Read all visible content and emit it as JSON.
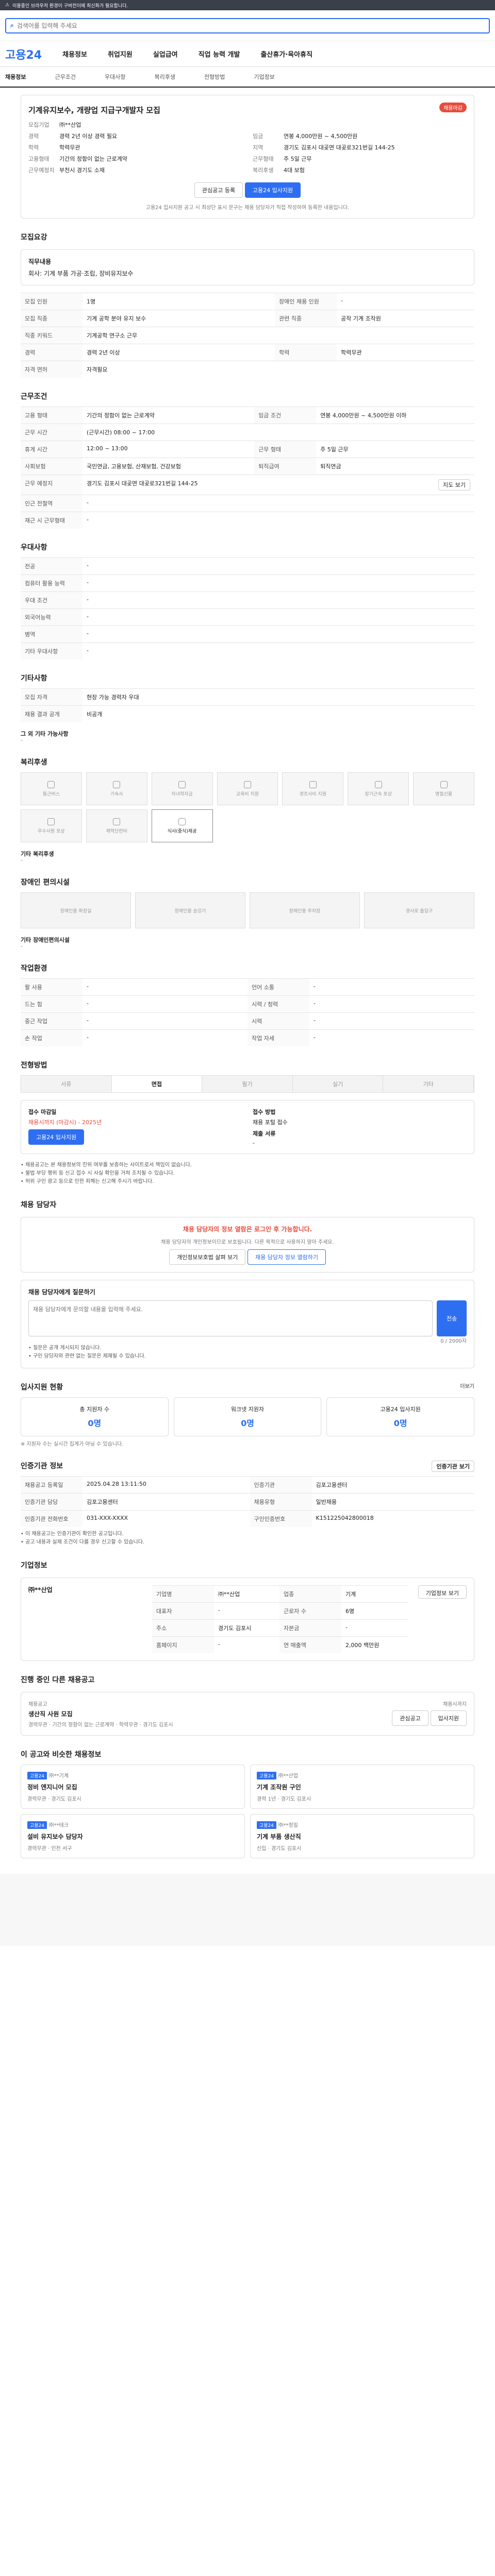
{
  "topbar": {
    "text": "이용중인 브라우저 환경이 구버전이에 최신화가 필요합니다."
  },
  "search": {
    "placeholder": "검색어를 입력해 주세요",
    "icon": "search-icon"
  },
  "gnb": {
    "logo": "고용24",
    "items": [
      "채용정보",
      "취업지원",
      "실업급여",
      "직업 능력 개발",
      "출산휴가·육아휴직"
    ]
  },
  "subnav": [
    "채용정보",
    "근무조건",
    "우대사항",
    "복리후생",
    "전형방법",
    "기업정보"
  ],
  "job": {
    "title": "기계유지보수, 개량업 지급구개발자 모집",
    "badge": "채용마감",
    "company_label": "모집기업",
    "company": "㈜**산업",
    "left": [
      [
        "경력",
        "경력 2년 이상 경력 필요"
      ],
      [
        "학력",
        "학력무관"
      ],
      [
        "고용형태",
        "기간의 정함이 없는 근로계약"
      ],
      [
        "근무예정지",
        "부천시 경기도 소재"
      ]
    ],
    "right": [
      [
        "임금",
        "연봉 4,000만원 ~ 4,500만원"
      ],
      [
        "지역",
        "경기도 김포시 대곶면 대곶로321번길 144-25"
      ],
      [
        "근무형태",
        "주 5일 근무"
      ],
      [
        "복리후생",
        "4대 보험"
      ]
    ],
    "scrap": "관심공고 등록",
    "apply": "고용24 입사지원",
    "note": "고용24 입사지원 공고 시 최상단 표시 문구는 채용 담당자가 직접 작성하여 등록한 내용입니다."
  },
  "recruit": {
    "title": "모집요강",
    "duty_label": "직무내용",
    "duty": "회사: 기계 부품 가공·조립, 장비유지보수",
    "rows": [
      [
        "모집 인원",
        "1명",
        "장애인 채용 인원",
        "-"
      ],
      [
        "모집 직종",
        "기계 공학 분야 유지 보수",
        "관련 직종",
        "공작 기계 조작원"
      ],
      [
        "직종 키워드",
        "기계공학 연구소 근무",
        "",
        ""
      ],
      [
        "경력",
        "경력 2년 이상",
        "학력",
        "학력무관"
      ],
      [
        "자격 면허",
        "자격필요",
        "",
        ""
      ]
    ]
  },
  "cond": {
    "title": "근무조건",
    "rows": [
      [
        "고용 형태",
        "기간의 정함이 없는 근로계약",
        "임금 조건",
        "연봉 4,000만원 ~ 4,500만원 이하"
      ],
      [
        "근무 시간",
        "(근무시간) 08:00 ~ 17:00",
        "",
        ""
      ],
      [
        "휴게 시간",
        "12:00 ~ 13:00",
        "근무 형태",
        "주 5일 근무"
      ],
      [
        "사회보험",
        "국민연금, 고용보험, 산재보험, 건강보험",
        "퇴직급여",
        "퇴직연금"
      ],
      [
        "근무 예정지",
        "경기도 김포시 대곶면 대곶로321번길 144-25",
        "",
        ""
      ],
      [
        "인근 전철역",
        "-",
        "",
        ""
      ],
      [
        "재근 시 근무형태",
        "-",
        "",
        ""
      ]
    ],
    "map_btn": "지도 보기"
  },
  "pref": {
    "title": "우대사항",
    "rows": [
      [
        "전공",
        "-"
      ],
      [
        "컴퓨터 활용 능력",
        "-"
      ],
      [
        "우대 조건",
        "-"
      ],
      [
        "외국어능력",
        "-"
      ],
      [
        "병역",
        "-"
      ],
      [
        "기타 우대사항",
        "-"
      ]
    ]
  },
  "etc": {
    "title": "기타사항",
    "rows": [
      [
        "모집 자격",
        "현장 가능 경력자 우대"
      ],
      [
        "채용 결과 공개",
        "비공개"
      ]
    ],
    "sub": "그 외 기타 가능사항",
    "sub_val": "-"
  },
  "welfare": {
    "title": "복리후생",
    "items": [
      "통근버스",
      "기숙사",
      "자녀학자금",
      "교육비 지원",
      "경조사비 지원",
      "장기근속 포상",
      "명절선물",
      "우수사원 포상",
      "체력단련비",
      "식사(중식)제공"
    ],
    "on": [
      9
    ],
    "etc_title": "기타 복리후생",
    "etc_val": "-"
  },
  "disability": {
    "title": "장애인 편의시설",
    "items": [
      "장애인용 화장실",
      "장애인용 승강기",
      "장애인용 주차장",
      "경사로 출입구"
    ],
    "etc_title": "기타 장애인편의시설",
    "etc_val": "-"
  },
  "env": {
    "title": "작업환경",
    "rows": [
      [
        "팔 사용",
        "-",
        "언어 소통",
        "-"
      ],
      [
        "드는 힘",
        "-",
        "시력 / 청력",
        "-"
      ],
      [
        "중근 작업",
        "-",
        "시력",
        "-"
      ],
      [
        "손 작업",
        "-",
        "작업 자세",
        "-"
      ]
    ]
  },
  "process": {
    "title": "전형방법",
    "steps": [
      "서류",
      "면접",
      "필기",
      "실기",
      "기타"
    ],
    "on": [
      1
    ],
    "apply_title": "접수 마감일",
    "apply_val": "채용시까지 (마감시) - 2025년",
    "submit_title": "접수 방법",
    "submit_val": "채용 포털 접수",
    "docs_title": "제출 서류",
    "docs_val": "-",
    "btn": "고용24 입사지원"
  },
  "notices": [
    "• 채용공고는 본 채용정보의 진위 여부를 보증하는 사이트로서 책임이 없습니다.",
    "• 불법 부당 행위 등 신고 접수 시 사실 확인을 거쳐 조치될 수 있습니다.",
    "• 허위 구인 광고 등으로 인한 피해는 신고해 주시기 바랍니다."
  ],
  "inquiry": {
    "title": "채용 담당자",
    "alert": "채용 담당자의 정보 열람은 로그인 후 가능합니다.",
    "desc": "채용 담당자의 개인정보이므로 보호됩니다. 다른 목적으로 사용하지 말아 주세요.",
    "btn1": "개인정보보호법 살펴 보기",
    "btn2": "채용 담당자 정보 열람하기",
    "q_title": "채용 담당자에게 질문하기",
    "q_placeholder": "채용 담당자에게 문의할 내용을 입력해 주세요.",
    "q_counter": "0 / 2000자",
    "q_btn": "전송",
    "tips": [
      "• 질문은 공개 게시되지 않습니다.",
      "• 구인 담당자와 관련 없는 질문은 제재될 수 있습니다."
    ]
  },
  "stats": {
    "title": "입사지원 현황",
    "more": "더보기",
    "items": [
      [
        "총 지원자 수",
        "0명"
      ],
      [
        "워크넷 지원자",
        "0명"
      ],
      [
        "고용24 입사지원",
        "0명"
      ]
    ],
    "note": "※ 지원자 수는 실시간 집계가 아닐 수 있습니다."
  },
  "basic": {
    "title": "인증기관 정보",
    "btn": "인증기관 보기",
    "rows": [
      [
        "채용공고 등록일",
        "2025.04.28 13:11:50",
        "인증기관",
        "김포고용센터"
      ],
      [
        "인증기관 담당",
        "김포고용센터",
        "채용유형",
        "일반채용"
      ],
      [
        "인증기관 전화번호",
        "031-XXX-XXXX",
        "구인인증번호",
        "K151225042800018"
      ]
    ],
    "notes": [
      "• 이 채용공고는 인증기관이 확인한 공고입니다.",
      "• 공고 내용과 실제 조건이 다를 경우 신고할 수 있습니다."
    ]
  },
  "company": {
    "title": "기업정보",
    "name": "㈜**산업",
    "rows": [
      [
        "기업명",
        "㈜**산업",
        "업종",
        "기계"
      ],
      [
        "대표자",
        "-",
        "근로자 수",
        "6명"
      ],
      [
        "주소",
        "경기도 김포시",
        "자본금",
        "-"
      ],
      [
        "홈페이지",
        "-",
        "연 매출액",
        "2,000 백만원"
      ]
    ],
    "btn": "기업정보 보기"
  },
  "related": {
    "title": "진행 중인 다른 채용공고",
    "company": "채용공고",
    "more": "더보기",
    "job": "생산직 사원 모집",
    "meta": [
      "경력무관",
      "기간의 정함이 없는 근로계약",
      "학력무관",
      "경기도 김포시"
    ],
    "deadline": "채용시까지",
    "tags": [
      "관심공고",
      "입사지원"
    ]
  },
  "recommend": {
    "title": "이 공고와 비슷한 채용정보",
    "items": [
      {
        "tag": "고용24",
        "co": "㈜**기계",
        "title": "정비 엔지니어 모집",
        "meta": [
          "경력무관",
          "경기도 김포시"
        ]
      },
      {
        "tag": "고용24",
        "co": "㈜**산업",
        "title": "기계 조작원 구인",
        "meta": [
          "경력 1년",
          "경기도 김포시"
        ]
      },
      {
        "tag": "고용24",
        "co": "㈜**테크",
        "title": "설비 유지보수 담당자",
        "meta": [
          "경력무관",
          "인천 서구"
        ]
      },
      {
        "tag": "고용24",
        "co": "㈜**정밀",
        "title": "기계 부품 생산직",
        "meta": [
          "신입",
          "경기도 김포시"
        ]
      }
    ]
  }
}
